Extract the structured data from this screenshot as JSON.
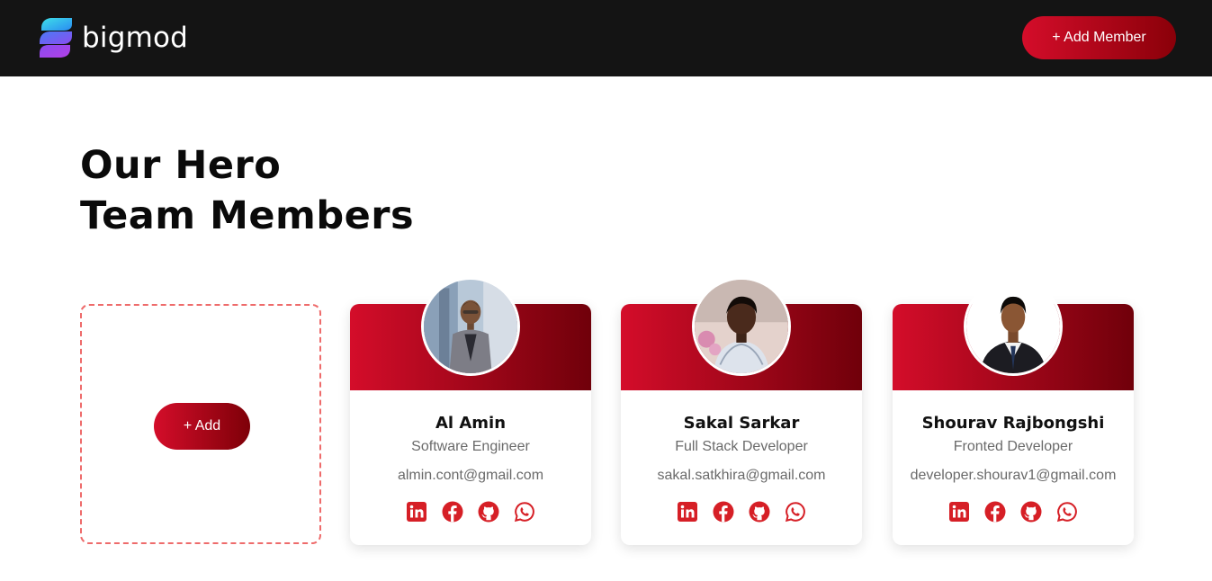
{
  "header": {
    "brand": "bigmod",
    "add_member_label": "+ Add Member"
  },
  "page": {
    "title_line1": "Our Hero",
    "title_line2": "Team Members"
  },
  "add_card": {
    "button_label": "+ Add"
  },
  "members": [
    {
      "name": "Al Amin",
      "role": "Software Engineer",
      "email": "almin.cont@gmail.com",
      "socials": [
        "linkedin-icon",
        "facebook-icon",
        "github-icon",
        "whatsapp-icon"
      ]
    },
    {
      "name": "Sakal Sarkar",
      "role": "Full Stack Developer",
      "email": "sakal.satkhira@gmail.com",
      "socials": [
        "linkedin-icon",
        "facebook-icon",
        "github-icon",
        "whatsapp-icon"
      ]
    },
    {
      "name": "Shourav Rajbongshi",
      "role": "Fronted Developer",
      "email": "developer.shourav1@gmail.com",
      "socials": [
        "linkedin-icon",
        "facebook-icon",
        "github-icon",
        "whatsapp-icon"
      ]
    }
  ],
  "colors": {
    "accent_start": "#d40d2a",
    "accent_end": "#7e0008",
    "topbar": "#141414",
    "icon": "#d61f26"
  }
}
